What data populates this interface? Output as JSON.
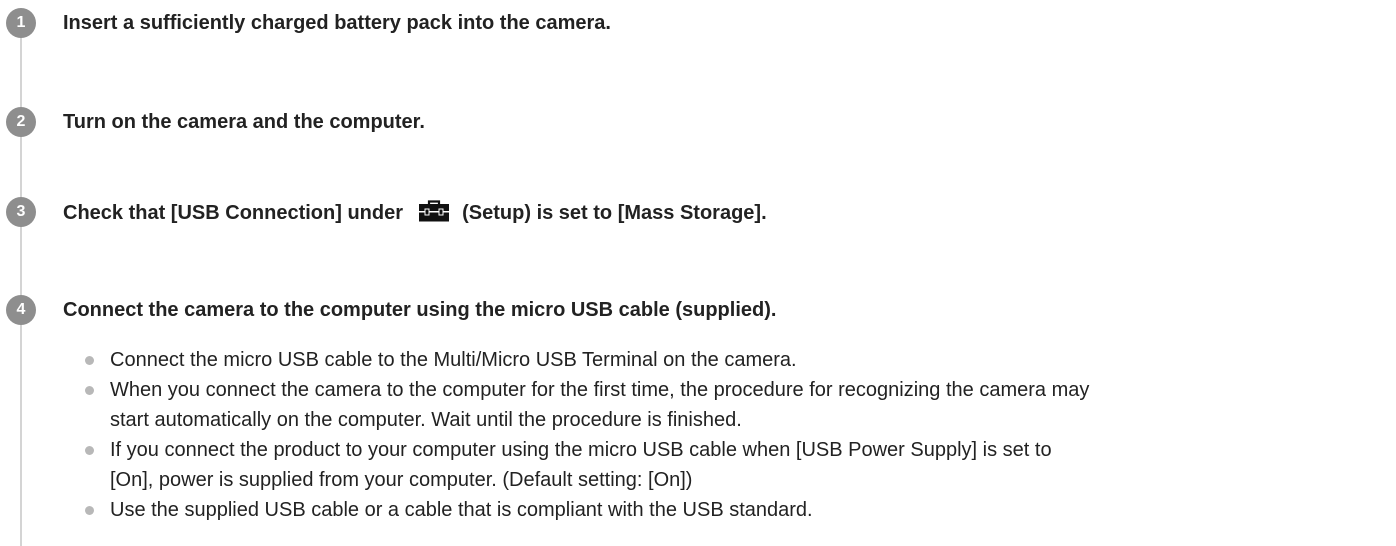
{
  "steps": [
    {
      "number": "1",
      "text": "Insert a sufficiently charged battery pack into the camera."
    },
    {
      "number": "2",
      "text": "Turn on the camera and the computer."
    },
    {
      "number": "3",
      "text_before": "Check that [USB Connection] under",
      "icon": "setup-toolbox-icon",
      "text_after": "(Setup) is set to [Mass Storage]."
    },
    {
      "number": "4",
      "text": "Connect the camera to the computer using the micro USB cable (supplied).",
      "bullets": [
        {
          "line1": "Connect the micro USB cable to the Multi/Micro USB Terminal on the camera.",
          "line2": ""
        },
        {
          "line1": "When you connect the camera to the computer for the first time, the procedure for recognizing the camera may",
          "line2": "start automatically on the computer. Wait until the procedure is finished."
        },
        {
          "line1": "If you connect the product to your computer using the micro USB cable when [USB Power Supply] is set to",
          "line2": "[On], power is supplied from your computer. (Default setting: [On])"
        },
        {
          "line1": "Use the supplied USB cable or a cable that is compliant with the USB standard.",
          "line2": ""
        }
      ]
    }
  ],
  "colors": {
    "text": "#222222",
    "step_circle": "#8e8e8e",
    "timeline": "#d4d4d4",
    "bullet": "#b8b8b8"
  }
}
